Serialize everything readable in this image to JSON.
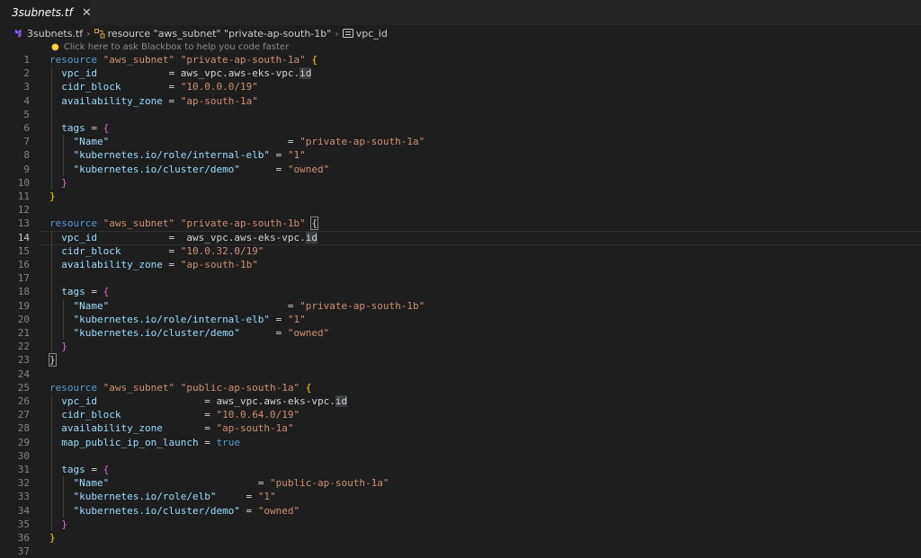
{
  "tab": {
    "label": "3subnets.tf",
    "close_label": "✕"
  },
  "breadcrumb": {
    "file": "3subnets.tf",
    "resource": "resource \"aws_subnet\" \"private-ap-south-1b\"",
    "field": "vpc_id"
  },
  "hint": {
    "text": "Click here to ask Blackbox to help you code faster"
  },
  "editor": {
    "current_line": 14,
    "lines": [
      {
        "n": "1",
        "t": [
          [
            "kw",
            "resource "
          ],
          [
            "str",
            "\"aws_subnet\" \"private-ap-south-1a\""
          ],
          [
            "op",
            " "
          ],
          [
            "brace",
            "{"
          ]
        ]
      },
      {
        "n": "2",
        "t": [
          [
            "op",
            "  "
          ],
          [
            "prop",
            "vpc_id"
          ],
          [
            "op",
            "            = "
          ],
          [
            "ref",
            "aws_vpc.aws-eks-vpc."
          ],
          [
            "hl",
            "id"
          ]
        ]
      },
      {
        "n": "3",
        "t": [
          [
            "op",
            "  "
          ],
          [
            "prop",
            "cidr_block"
          ],
          [
            "op",
            "        = "
          ],
          [
            "str",
            "\"10.0.0.0/19\""
          ]
        ]
      },
      {
        "n": "4",
        "t": [
          [
            "op",
            "  "
          ],
          [
            "prop",
            "availability_zone"
          ],
          [
            "op",
            " = "
          ],
          [
            "str",
            "\"ap-south-1a\""
          ]
        ]
      },
      {
        "n": "5",
        "t": []
      },
      {
        "n": "6",
        "t": [
          [
            "op",
            "  "
          ],
          [
            "prop",
            "tags"
          ],
          [
            "op",
            " = "
          ],
          [
            "brace2",
            "{"
          ]
        ]
      },
      {
        "n": "7",
        "t": [
          [
            "op",
            "    "
          ],
          [
            "prop",
            "\"Name\""
          ],
          [
            "op",
            "                              = "
          ],
          [
            "str",
            "\"private-ap-south-1a\""
          ]
        ]
      },
      {
        "n": "8",
        "t": [
          [
            "op",
            "    "
          ],
          [
            "prop",
            "\"kubernetes.io/role/internal-elb\""
          ],
          [
            "op",
            " = "
          ],
          [
            "str",
            "\"1\""
          ]
        ]
      },
      {
        "n": "9",
        "t": [
          [
            "op",
            "    "
          ],
          [
            "prop",
            "\"kubernetes.io/cluster/demo\""
          ],
          [
            "op",
            "      = "
          ],
          [
            "str",
            "\"owned\""
          ]
        ]
      },
      {
        "n": "10",
        "t": [
          [
            "op",
            "  "
          ],
          [
            "brace2",
            "}"
          ]
        ]
      },
      {
        "n": "11",
        "t": [
          [
            "brace",
            "}"
          ]
        ]
      },
      {
        "n": "12",
        "t": []
      },
      {
        "n": "13",
        "t": [
          [
            "kw",
            "resource "
          ],
          [
            "str",
            "\"aws_subnet\" \"private-ap-south-1b\""
          ],
          [
            "op",
            " "
          ],
          [
            "match",
            "{"
          ]
        ]
      },
      {
        "n": "14",
        "t": [
          [
            "op",
            "  "
          ],
          [
            "prop",
            "vpc_id"
          ],
          [
            "op",
            "            =  "
          ],
          [
            "ref",
            "aws_vpc.aws-eks-vpc."
          ],
          [
            "hl",
            "id"
          ]
        ]
      },
      {
        "n": "15",
        "t": [
          [
            "op",
            "  "
          ],
          [
            "prop",
            "cidr_block"
          ],
          [
            "op",
            "        = "
          ],
          [
            "str",
            "\"10.0.32.0/19\""
          ]
        ]
      },
      {
        "n": "16",
        "t": [
          [
            "op",
            "  "
          ],
          [
            "prop",
            "availability_zone"
          ],
          [
            "op",
            " = "
          ],
          [
            "str",
            "\"ap-south-1b\""
          ]
        ]
      },
      {
        "n": "17",
        "t": []
      },
      {
        "n": "18",
        "t": [
          [
            "op",
            "  "
          ],
          [
            "prop",
            "tags"
          ],
          [
            "op",
            " = "
          ],
          [
            "brace2",
            "{"
          ]
        ]
      },
      {
        "n": "19",
        "t": [
          [
            "op",
            "    "
          ],
          [
            "prop",
            "\"Name\""
          ],
          [
            "op",
            "                              = "
          ],
          [
            "str",
            "\"private-ap-south-1b\""
          ]
        ]
      },
      {
        "n": "20",
        "t": [
          [
            "op",
            "    "
          ],
          [
            "prop",
            "\"kubernetes.io/role/internal-elb\""
          ],
          [
            "op",
            " = "
          ],
          [
            "str",
            "\"1\""
          ]
        ]
      },
      {
        "n": "21",
        "t": [
          [
            "op",
            "    "
          ],
          [
            "prop",
            "\"kubernetes.io/cluster/demo\""
          ],
          [
            "op",
            "      = "
          ],
          [
            "str",
            "\"owned\""
          ]
        ]
      },
      {
        "n": "22",
        "t": [
          [
            "op",
            "  "
          ],
          [
            "brace2",
            "}"
          ]
        ]
      },
      {
        "n": "23",
        "t": [
          [
            "match",
            "}"
          ]
        ]
      },
      {
        "n": "24",
        "t": []
      },
      {
        "n": "25",
        "t": [
          [
            "kw",
            "resource "
          ],
          [
            "str",
            "\"aws_subnet\" \"public-ap-south-1a\""
          ],
          [
            "op",
            " "
          ],
          [
            "brace",
            "{"
          ]
        ]
      },
      {
        "n": "26",
        "t": [
          [
            "op",
            "  "
          ],
          [
            "prop",
            "vpc_id"
          ],
          [
            "op",
            "                  = "
          ],
          [
            "ref",
            "aws_vpc.aws-eks-vpc."
          ],
          [
            "hl",
            "id"
          ]
        ]
      },
      {
        "n": "27",
        "t": [
          [
            "op",
            "  "
          ],
          [
            "prop",
            "cidr_block"
          ],
          [
            "op",
            "              = "
          ],
          [
            "str",
            "\"10.0.64.0/19\""
          ]
        ]
      },
      {
        "n": "28",
        "t": [
          [
            "op",
            "  "
          ],
          [
            "prop",
            "availability_zone"
          ],
          [
            "op",
            "       = "
          ],
          [
            "str",
            "\"ap-south-1a\""
          ]
        ]
      },
      {
        "n": "29",
        "t": [
          [
            "op",
            "  "
          ],
          [
            "prop",
            "map_public_ip_on_launch"
          ],
          [
            "op",
            " = "
          ],
          [
            "bool",
            "true"
          ]
        ]
      },
      {
        "n": "30",
        "t": []
      },
      {
        "n": "31",
        "t": [
          [
            "op",
            "  "
          ],
          [
            "prop",
            "tags"
          ],
          [
            "op",
            " = "
          ],
          [
            "brace2",
            "{"
          ]
        ]
      },
      {
        "n": "32",
        "t": [
          [
            "op",
            "    "
          ],
          [
            "prop",
            "\"Name\""
          ],
          [
            "op",
            "                         = "
          ],
          [
            "str",
            "\"public-ap-south-1a\""
          ]
        ]
      },
      {
        "n": "33",
        "t": [
          [
            "op",
            "    "
          ],
          [
            "prop",
            "\"kubernetes.io/role/elb\""
          ],
          [
            "op",
            "     = "
          ],
          [
            "str",
            "\"1\""
          ]
        ]
      },
      {
        "n": "34",
        "t": [
          [
            "op",
            "    "
          ],
          [
            "prop",
            "\"kubernetes.io/cluster/demo\""
          ],
          [
            "op",
            " = "
          ],
          [
            "str",
            "\"owned\""
          ]
        ]
      },
      {
        "n": "35",
        "t": [
          [
            "op",
            "  "
          ],
          [
            "brace2",
            "}"
          ]
        ]
      },
      {
        "n": "36",
        "t": [
          [
            "brace",
            "}"
          ]
        ]
      },
      {
        "n": "37",
        "t": []
      }
    ]
  }
}
